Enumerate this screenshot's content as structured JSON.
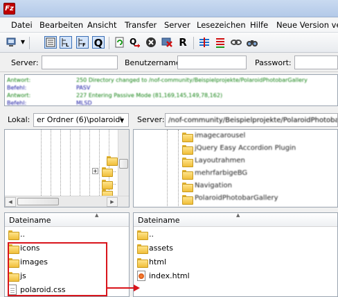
{
  "app": {
    "icon_letter": "Fz"
  },
  "menu": [
    "Datei",
    "Bearbeiten",
    "Ansicht",
    "Transfer",
    "Server",
    "Lesezeichen",
    "Hilfe",
    "Neue Version ver"
  ],
  "toolbar": {
    "icons": [
      "site-manager-icon",
      "dropdown-icon",
      "toggle-log-icon",
      "toggle-local-tree-icon",
      "toggle-remote-tree-icon",
      "toggle-queue-icon",
      "refresh-icon",
      "process-queue-icon",
      "cancel-icon",
      "disconnect-icon",
      "reconnect-icon",
      "filter-icon",
      "sync-browse-icon",
      "compare-icon",
      "search-icon"
    ],
    "q_label": "Q",
    "r_label": "R"
  },
  "quickconnect": {
    "server_label": "Server:",
    "user_label": "Benutzername:",
    "pass_label": "Passwort:",
    "server_value": "",
    "user_value": "",
    "pass_value": ""
  },
  "log": [
    {
      "key": "Antwort:",
      "value": "250 Directory changed to /nof-community/Beispielprojekte/PolaroidPhotobarGallery",
      "color": "#108010"
    },
    {
      "key": "Befehl:",
      "value": "PASV",
      "color": "#1010a0"
    },
    {
      "key": "Antwort:",
      "value": "227 Entering Passive Mode (81,169,145,149,78,162)",
      "color": "#108010"
    },
    {
      "key": "Befehl:",
      "value": "MLSD",
      "color": "#1010a0"
    }
  ],
  "local": {
    "label": "Lokal:",
    "path": "er Ordner (6)\\polaroid\\",
    "column_header": "Dateiname",
    "files": [
      {
        "name": "..",
        "type": "folder"
      },
      {
        "name": "icons",
        "type": "folder"
      },
      {
        "name": "images",
        "type": "folder"
      },
      {
        "name": "js",
        "type": "folder"
      },
      {
        "name": "polaroid.css",
        "type": "css"
      }
    ]
  },
  "remote": {
    "label": "Server:",
    "path": "/nof-community/Beispielprojekte/PolaroidPhotobarGallery",
    "tree": [
      "imagecarousel",
      "jQuery Easy Accordion Plugin",
      "Layoutrahmen",
      "mehrfarbigeBG",
      "Navigation",
      "PolaroidPhotobarGallery"
    ],
    "column_header": "Dateiname",
    "files": [
      {
        "name": "..",
        "type": "folder"
      },
      {
        "name": "assets",
        "type": "folder"
      },
      {
        "name": "html",
        "type": "folder"
      },
      {
        "name": "index.html",
        "type": "html"
      }
    ]
  },
  "colors": {
    "annotation": "#d9141b",
    "folder": "#f0be3a"
  }
}
